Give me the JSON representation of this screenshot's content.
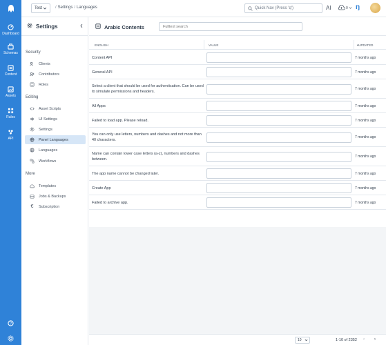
{
  "rail": {
    "items": [
      {
        "label": "Dashboard",
        "icon": "dashboard-icon",
        "active": false
      },
      {
        "label": "Schemas",
        "icon": "schemas-icon",
        "active": false
      },
      {
        "label": "Content",
        "icon": "content-icon",
        "active": false
      },
      {
        "label": "Assets",
        "icon": "assets-icon",
        "active": false
      },
      {
        "label": "Rules",
        "icon": "rules-icon",
        "active": false
      },
      {
        "label": "API",
        "icon": "api-icon",
        "active": false
      }
    ],
    "accent": "#2f82d8"
  },
  "topbar": {
    "app": "Test",
    "breadcrumb": [
      "Settings",
      "Languages"
    ],
    "search_placeholder": "Quick Nav (Press 'q')",
    "ai_label": "AI",
    "cloud_count": "0",
    "brand_glyph": "ŋ"
  },
  "settings": {
    "title": "Settings",
    "sections": [
      {
        "title": "Security",
        "items": [
          {
            "label": "Clients",
            "icon": "clients-icon"
          },
          {
            "label": "Contributors",
            "icon": "contributors-icon"
          },
          {
            "label": "Roles",
            "icon": "roles-icon"
          }
        ]
      },
      {
        "title": "Editing",
        "items": [
          {
            "label": "Asset Scripts",
            "icon": "code-icon"
          },
          {
            "label": "UI Settings",
            "icon": "asterisk-icon"
          },
          {
            "label": "Settings",
            "icon": "gear-icon"
          },
          {
            "label": "Panel Languages",
            "icon": "globe-icon",
            "active": true
          },
          {
            "label": "Languages",
            "icon": "globe-icon"
          },
          {
            "label": "Workflows",
            "icon": "workflow-icon"
          }
        ]
      },
      {
        "title": "More",
        "items": [
          {
            "label": "Templates",
            "icon": "cloud-icon"
          },
          {
            "label": "Jobs & Backups",
            "icon": "backup-icon"
          },
          {
            "label": "Subscription",
            "icon": "euro-icon"
          }
        ]
      }
    ]
  },
  "main": {
    "title": "Arabic Contents",
    "fulltext_placeholder": "Fulltext search",
    "columns": {
      "english": "ENGLISH",
      "value": "VALUE",
      "updated": "UPDATED"
    },
    "rows": [
      {
        "english": "Content API",
        "updated": "7 months ago"
      },
      {
        "english": "General API",
        "updated": "7 months ago"
      },
      {
        "english": "Select a client that should be used for authentication. Can be used to simulate permissions and headers.",
        "updated": "7 months ago"
      },
      {
        "english": "All Apps",
        "updated": "7 months ago"
      },
      {
        "english": "Failed to load app. Please reload.",
        "updated": "7 months ago"
      },
      {
        "english": "You can only use letters, numbers and dashes and not more than 40 characters.",
        "updated": "7 months ago"
      },
      {
        "english": "Name can contain lower case letters (a-z), numbers and dashes between.",
        "updated": "7 months ago"
      },
      {
        "english": "The app name cannot be changed later.",
        "updated": "7 months ago"
      },
      {
        "english": "Create App",
        "updated": "7 months ago"
      },
      {
        "english": "Failed to archive app.",
        "updated": "7 months ago"
      }
    ],
    "pagination": {
      "page_size": "10",
      "info": "1-10 of 2352",
      "prev": "‹",
      "next": "›"
    }
  }
}
